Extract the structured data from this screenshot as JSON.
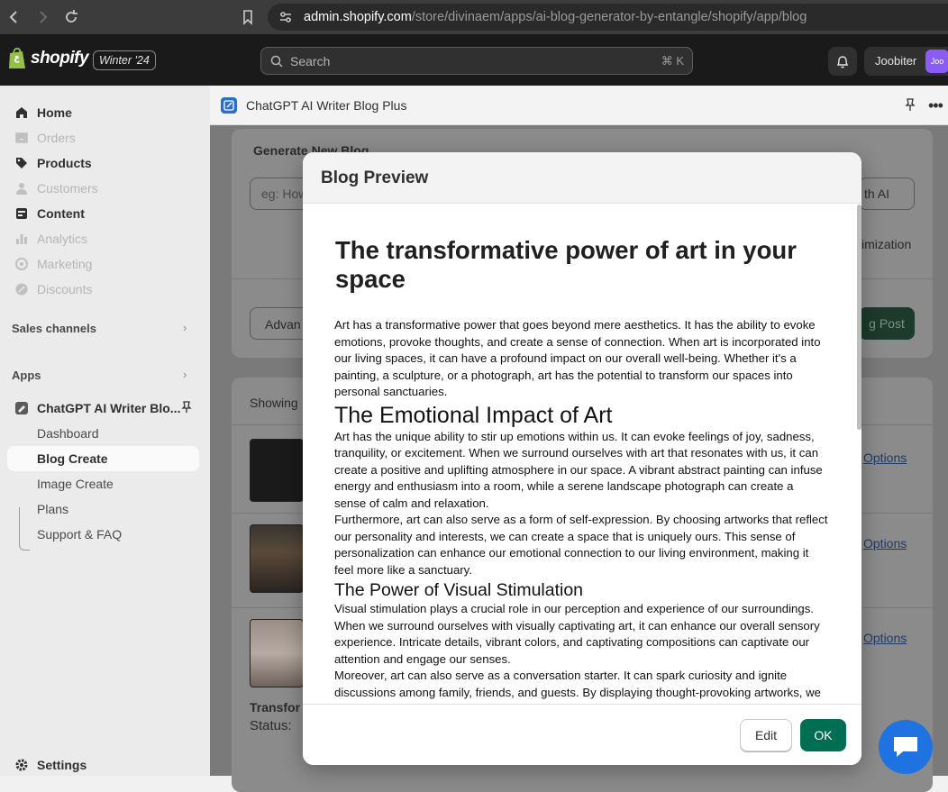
{
  "browser": {
    "url_domain": "admin.shopify.com",
    "url_path": "/store/divinaem/apps/ai-blog-generator-by-entangle/shopify/app/blog"
  },
  "topbar": {
    "logo_text": "shopify",
    "edition": "Winter '24",
    "search_placeholder": "Search",
    "search_shortcut": "⌘ K",
    "account_name": "Joobiter",
    "account_initials": "Joo"
  },
  "sidebar": {
    "items": [
      {
        "label": "Home",
        "icon": "home-icon",
        "state": "normal"
      },
      {
        "label": "Orders",
        "icon": "orders-icon",
        "state": "dim"
      },
      {
        "label": "Products",
        "icon": "tag-icon",
        "state": "normal"
      },
      {
        "label": "Customers",
        "icon": "person-icon",
        "state": "dim"
      },
      {
        "label": "Content",
        "icon": "content-icon",
        "state": "normal"
      },
      {
        "label": "Analytics",
        "icon": "bar-chart-icon",
        "state": "dim"
      },
      {
        "label": "Marketing",
        "icon": "target-icon",
        "state": "dim"
      },
      {
        "label": "Discounts",
        "icon": "discount-icon",
        "state": "dim"
      }
    ],
    "sales_channels": "Sales channels",
    "apps": "Apps",
    "app_name": "ChatGPT AI Writer Blo...",
    "app_subitems": [
      "Dashboard",
      "Blog Create",
      "Image Create",
      "Plans",
      "Support & FAQ"
    ],
    "selected_subitem": "Blog Create",
    "settings": "Settings"
  },
  "app_header": {
    "title": "ChatGPT AI Writer Blog Plus"
  },
  "background": {
    "generate_title": "Generate New Blog",
    "prompt_placeholder": "eg: How",
    "write_ai_fragment": "th AI",
    "optimization_fragment": "imization",
    "advanced_fragment": "Advan",
    "post_fragment": "g Post",
    "showing_fragment": "Showing",
    "options_link": "Options",
    "transform_fragment": "Transfor",
    "status_fragment": "Status:"
  },
  "modal": {
    "title": "Blog Preview",
    "article_title": "The transformative power of art in your space",
    "intro": "Art has a transformative power that goes beyond mere aesthetics. It has the ability to evoke emotions, provoke thoughts, and create a sense of connection. When art is incorporated into our living spaces, it can have a profound impact on our overall well-being. Whether it's a painting, a sculpture, or a photograph, art has the potential to transform our spaces into personal sanctuaries.",
    "h2": "The Emotional Impact of Art",
    "p2": "Art has the unique ability to stir up emotions within us. It can evoke feelings of joy, sadness, tranquility, or excitement. When we surround ourselves with art that resonates with us, it can create a positive and uplifting atmosphere in our space. A vibrant abstract painting can infuse energy and enthusiasm into a room, while a serene landscape photograph can create a sense of calm and relaxation.",
    "p3": "Furthermore, art can also serve as a form of self-expression. By choosing artworks that reflect our personality and interests, we can create a space that is uniquely ours. This sense of personalization can enhance our emotional connection to our living environment, making it feel more like a sanctuary.",
    "h3": "The Power of Visual Stimulation",
    "p4": "Visual stimulation plays a crucial role in our perception and experience of our surroundings. When we surround ourselves with visually captivating art, it can enhance our overall sensory experience. Intricate details, vibrant colors, and captivating compositions can captivate our attention and engage our senses.",
    "p5": "Moreover, art can also serve as a conversation starter. It can spark curiosity and ignite discussions among family, friends, and guests. By displaying thought-provoking artworks, we",
    "edit_label": "Edit",
    "ok_label": "OK"
  },
  "colors": {
    "primary_button": "#006e52",
    "topbar": "#1a1a1a",
    "chat_bubble": "#1f73e0"
  }
}
